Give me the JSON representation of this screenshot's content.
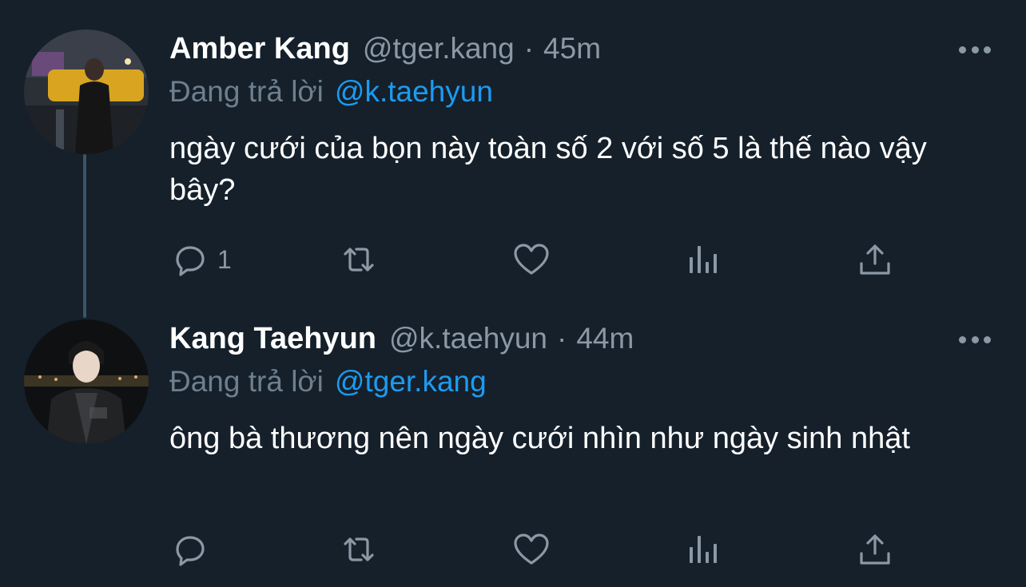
{
  "tweets": [
    {
      "name": "Amber Kang",
      "handle": "@tger.kang",
      "separator": "·",
      "time": "45m",
      "reply_prefix": "Đang trả lời",
      "reply_to": "@k.taehyun",
      "text": "ngày cưới của bọn này toàn số 2 với số 5 là thế nào vậy bây?",
      "reply_count": "1",
      "retweet_count": "",
      "like_count": ""
    },
    {
      "name": "Kang Taehyun",
      "handle": "@k.taehyun",
      "separator": "·",
      "time": "44m",
      "reply_prefix": "Đang trả lời",
      "reply_to": "@tger.kang",
      "text": "ông bà thương nên ngày cưới nhìn như ngày sinh nhật",
      "reply_count": "",
      "retweet_count": "",
      "like_count": ""
    }
  ],
  "colors": {
    "background": "#15202b",
    "secondary_text": "#8b98a5",
    "mention": "#1d9bf0",
    "icon": "#8b98a5"
  },
  "icons": [
    "reply-icon",
    "retweet-icon",
    "like-icon",
    "analytics-icon",
    "share-icon",
    "more-icon"
  ]
}
